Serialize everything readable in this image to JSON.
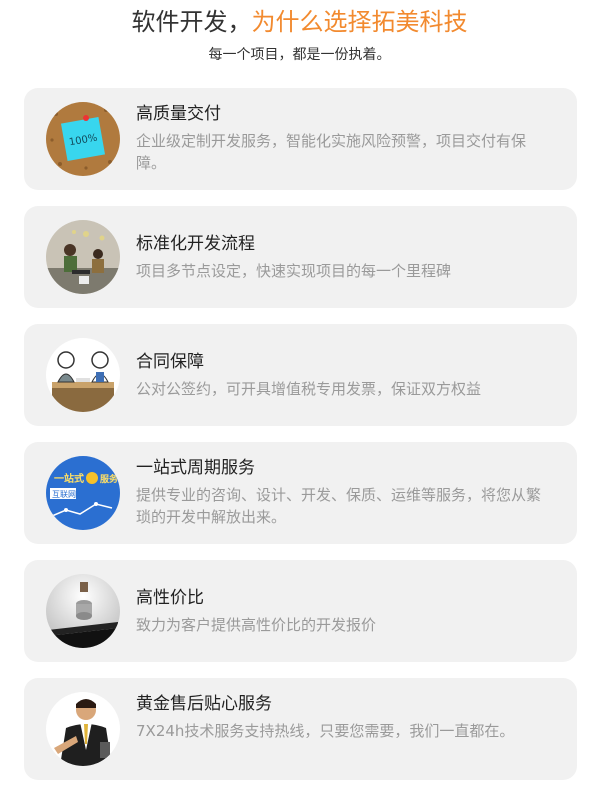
{
  "header": {
    "title_prefix": "软件开发，",
    "title_accent": "为什么选择拓美科技",
    "subtitle": "每一个项目，都是一份执着。"
  },
  "colors": {
    "accent": "#f28a2f",
    "card_bg": "#f1f1f1",
    "desc": "#9a9a9a"
  },
  "cards": [
    {
      "title": "高质量交付",
      "desc": "企业级定制开发服务，智能化实施风险预警，项目交付有保障。",
      "icon": "sticky-note-100-icon",
      "icon_text": "100%"
    },
    {
      "title": "标准化开发流程",
      "desc": "项目多节点设定，快速实现项目的每一个里程碑",
      "icon": "team-workflow-icon"
    },
    {
      "title": "合同保障",
      "desc": "公对公签约，可开具增值税专用发票，保证双方权益",
      "icon": "contract-handshake-icon"
    },
    {
      "title": "一站式周期服务",
      "desc": "提供专业的咨询、设计、开发、保质、运维等服务，将您从繁琐的开发中解放出来。",
      "icon": "one-stop-service-icon",
      "icon_text_top": "一站式",
      "icon_text_mid": "服务",
      "icon_text_badge": "互联网"
    },
    {
      "title": "高性价比",
      "desc": "致力为客户提供高性价比的开发报价",
      "icon": "coin-balance-icon"
    },
    {
      "title": "黄金售后贴心服务",
      "desc": "7X24h技术服务支持热线，只要您需要，我们一直都在。",
      "icon": "support-staff-icon"
    }
  ]
}
